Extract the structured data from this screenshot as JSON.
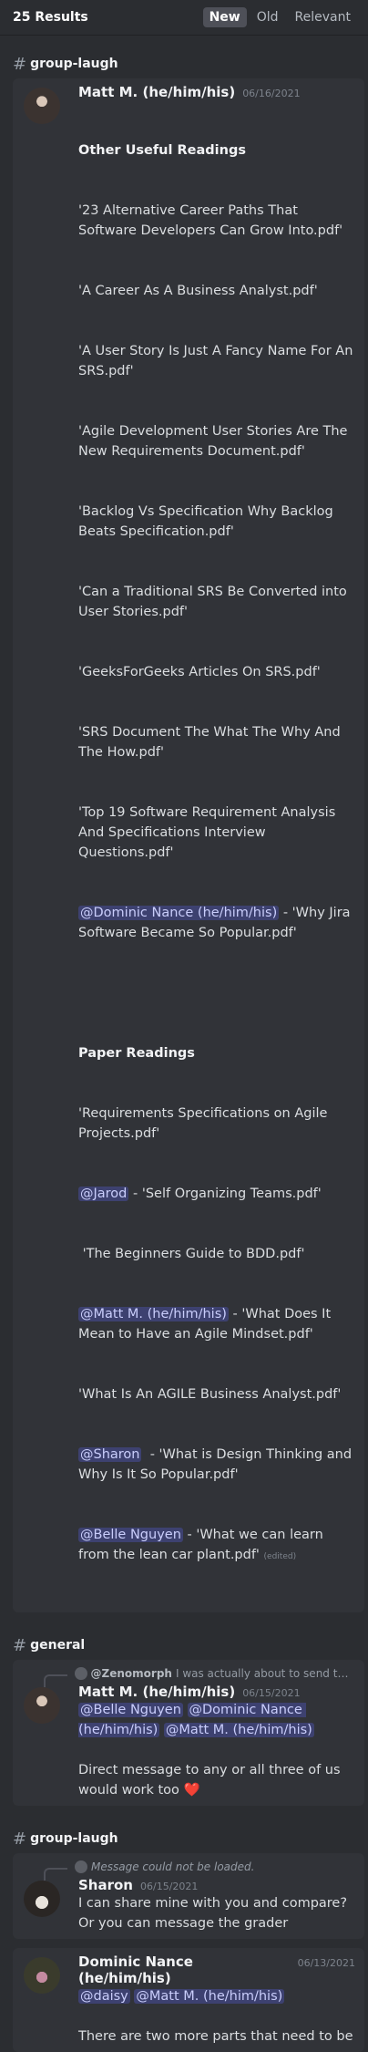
{
  "header": {
    "results": "25 Results",
    "tabs": [
      "New",
      "Old",
      "Relevant"
    ]
  },
  "groups": [
    {
      "channel": "group-laugh",
      "author": "Matt M. (he/him/his)",
      "date": "06/16/2021",
      "lines": [
        "Other Useful Readings",
        "'23 Alternative Career Paths That Software Developers Can Grow Into.pdf'",
        "'A Career As A Business Analyst.pdf'",
        "'A User Story Is Just A Fancy Name For An SRS.pdf'",
        "'Agile Development User Stories Are The New Requirements Document.pdf'",
        "'Backlog Vs Specification Why Backlog Beats Specification.pdf'",
        "'Can a Traditional SRS Be Converted into User Stories.pdf'",
        "'GeeksForGeeks Articles On SRS.pdf'",
        "'SRS Document The What The Why And The How.pdf'",
        "'Top 19 Software Requirement Analysis And Specifications Interview Questions.pdf'",
        "@Dominic Nance (he/him/his)",
        " - 'Why Jira Software Became So Popular.pdf'",
        "Paper Readings",
        "'Requirements Specifications on Agile Projects.pdf'",
        "@Jarod",
        " - 'Self Organizing Teams.pdf'",
        " 'The Beginners Guide to BDD.pdf'",
        "@Matt M. (he/him/his)",
        " - 'What Does It Mean to Have an Agile Mindset.pdf'",
        "'What Is An AGILE Business Analyst.pdf'",
        "@Sharon",
        "  - 'What is Design Thinking and Why Is It So Popular.pdf'",
        "@Belle Nguyen",
        " - 'What we can learn from the lean car plant.pdf'",
        "(edited)"
      ]
    },
    {
      "channel": "general",
      "reply_user": "@Zenomorph",
      "reply_text": "I was actually about to send the...",
      "author": "Matt M. (he/him/his)",
      "date": "06/15/2021",
      "mentions": [
        "@Belle Nguyen",
        "@Dominic Nance (he/him/his)",
        "@Matt M. (he/him/his)"
      ],
      "text": "Direct message to any or all three of us would work too",
      "emoji": "❤️"
    },
    {
      "channel": "group-laugh",
      "reply_text": "Message could not be loaded.",
      "author": "Sharon",
      "date": "06/15/2021",
      "text": "I can share mine with you and compare? Or you can message the grader"
    },
    {
      "author": "Dominic Nance (he/him/his)",
      "date": "06/13/2021",
      "mentions": [
        "@daisy",
        "@Matt M. (he/him/his)"
      ],
      "text": "There are two more parts that need to be"
    }
  ],
  "colors": {
    "background": "#2b2d31",
    "card": "#313338",
    "mention": "#5865f2"
  }
}
